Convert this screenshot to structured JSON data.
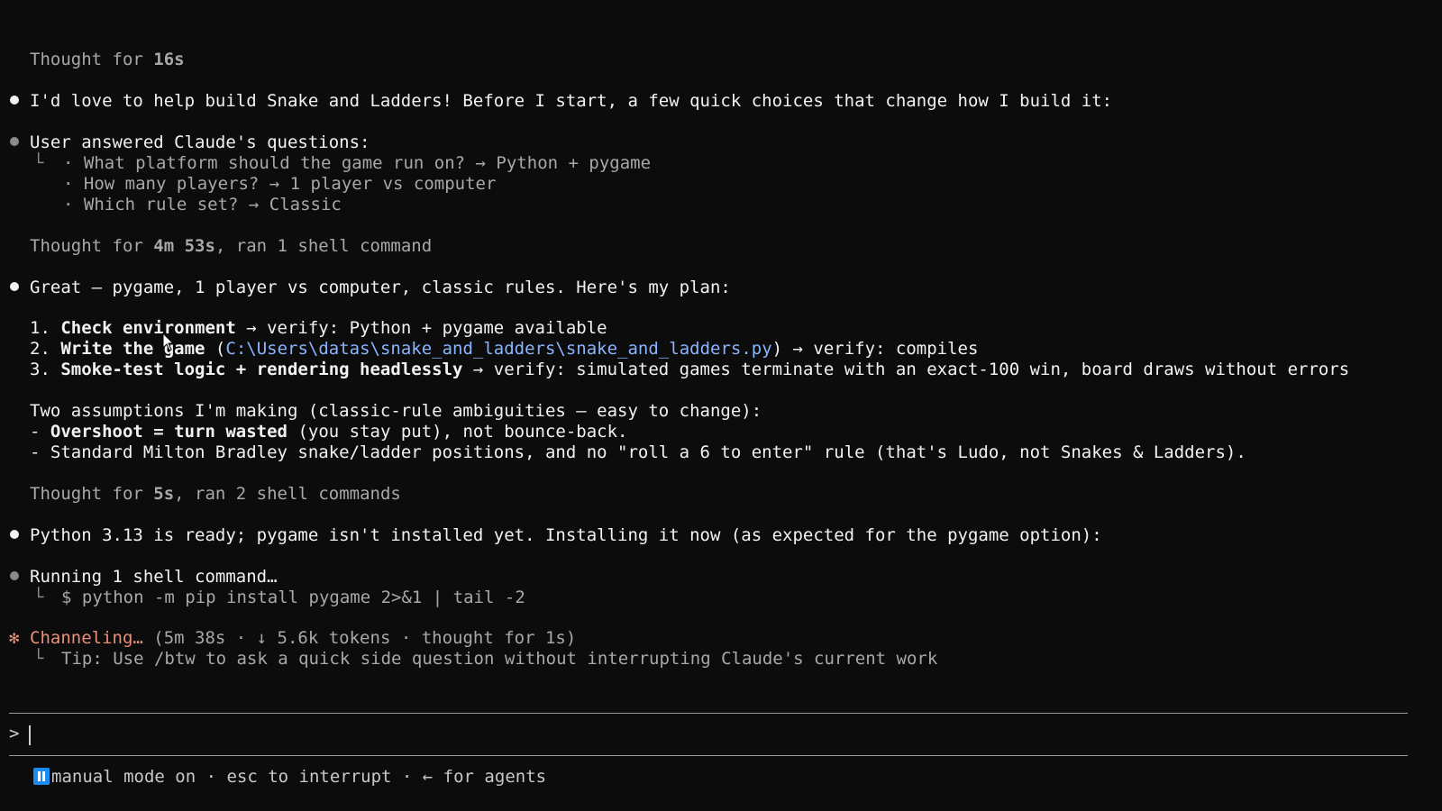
{
  "transcript": {
    "thought1": {
      "prefix": "Thought for ",
      "time": "16s"
    },
    "msg1": "I'd love to help build Snake and Ladders! Before I start, a few quick choices that change how I build it:",
    "answers": {
      "title": "User answered Claude's questions:",
      "items": [
        "· What platform should the game run on? → Python + pygame",
        "· How many players? → 1 player vs computer",
        "· Which rule set? → Classic"
      ]
    },
    "thought2": {
      "prefix": "Thought for ",
      "time": "4m 53s",
      "suffix": ", ran 1 shell command"
    },
    "msg2": "Great — pygame, 1 player vs computer, classic rules. Here's my plan:",
    "plan": [
      {
        "num": "1. ",
        "head": "Check environment",
        "rest": " → verify: Python + pygame available"
      },
      {
        "num": "2. ",
        "head": "Write the game",
        "rest_pre": " (",
        "path": "C:\\Users\\datas\\snake_and_ladders\\snake_and_ladders.py",
        "rest": ") → verify: compiles"
      },
      {
        "num": "3. ",
        "head": "Smoke-test logic + rendering headlessly",
        "rest": " → verify: simulated games terminate with an exact-100 win, board draws without errors"
      }
    ],
    "assumptions": {
      "title": "Two assumptions I'm making (classic-rule ambiguities — easy to change):",
      "items": [
        {
          "dash": "- ",
          "head": "Overshoot = turn wasted",
          "rest": " (you stay put), not bounce-back."
        },
        {
          "dash": "- ",
          "head": "",
          "rest": "Standard Milton Bradley snake/ladder positions, and no \"roll a 6 to enter\" rule (that's Ludo, not Snakes & Ladders)."
        }
      ]
    },
    "thought3": {
      "prefix": "Thought for ",
      "time": "5s",
      "suffix": ", ran 2 shell commands"
    },
    "msg3": "Python 3.13 is ready; pygame isn't installed yet. Installing it now (as expected for the pygame option):",
    "running": {
      "title": "Running 1 shell command…",
      "command": "$ python -m pip install pygame 2>&1 | tail -2"
    },
    "status": {
      "glyph": "✻",
      "label": "Channeling…",
      "details": " (5m 38s · ↓ 5.6k tokens · thought for 1s)",
      "tip": "Tip: Use /btw to ask a quick side question without interrupting Claude's current work"
    }
  },
  "input": {
    "prompt": ">",
    "value": ""
  },
  "footer": {
    "mode": "manual mode on · esc to interrupt · ← for agents"
  },
  "colors": {
    "background": "#0c0c0c",
    "text": "#d4d4d4",
    "accent": "#e8907a",
    "path": "#8ab4ff",
    "mode_icon": "#1d8cf0"
  },
  "icons": {
    "bullet": "filled-circle-icon",
    "spinner": "asterisk-spinner-icon",
    "tree": "tree-branch-icon",
    "mode": "pause-icon",
    "cursor": "mouse-pointer-icon"
  }
}
